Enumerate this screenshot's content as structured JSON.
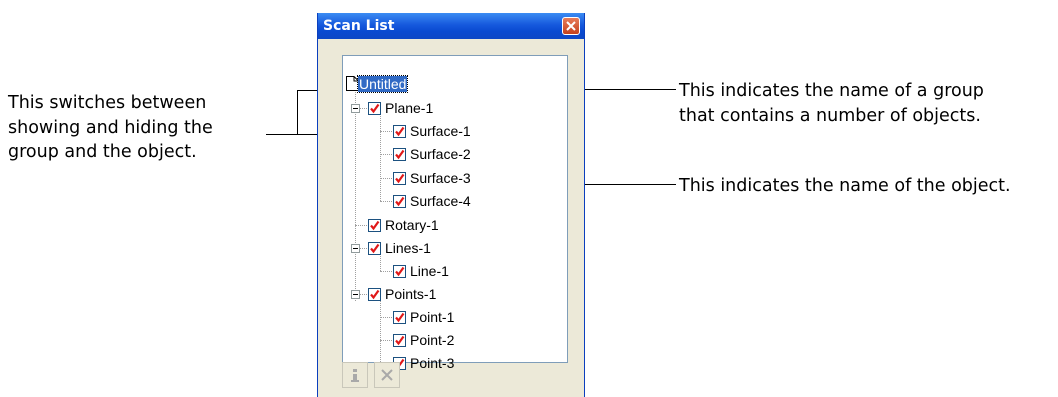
{
  "window": {
    "title": "Scan List"
  },
  "tree": {
    "root": {
      "label": "Untitled",
      "icon": "document-icon"
    },
    "items": [
      {
        "label": "Plane-1",
        "checked": true,
        "type": "group"
      },
      {
        "label": "Surface-1",
        "checked": true,
        "type": "object"
      },
      {
        "label": "Surface-2",
        "checked": true,
        "type": "object"
      },
      {
        "label": "Surface-3",
        "checked": true,
        "type": "object"
      },
      {
        "label": "Surface-4",
        "checked": true,
        "type": "object"
      },
      {
        "label": "Rotary-1",
        "checked": true,
        "type": "object"
      },
      {
        "label": "Lines-1",
        "checked": true,
        "type": "group"
      },
      {
        "label": "Line-1",
        "checked": true,
        "type": "object"
      },
      {
        "label": "Points-1",
        "checked": true,
        "type": "group"
      },
      {
        "label": "Point-1",
        "checked": true,
        "type": "object"
      },
      {
        "label": "Point-2",
        "checked": true,
        "type": "object"
      },
      {
        "label": "Point-3",
        "checked": true,
        "type": "object"
      }
    ]
  },
  "toolbar": [
    {
      "icon": "info-icon",
      "enabled": false
    },
    {
      "icon": "delete-icon",
      "enabled": false
    }
  ],
  "annotations": {
    "left": {
      "line1": "This switches between",
      "line2": "showing and hiding the",
      "line3": "group and the object."
    },
    "group": {
      "line1": "This indicates the name of a group",
      "line2": "that contains a number of objects."
    },
    "object": "This indicates the name of the object."
  },
  "colors": {
    "titlebar": "#0a4ad1",
    "check": "#e01818",
    "selection": "#316ac5"
  }
}
